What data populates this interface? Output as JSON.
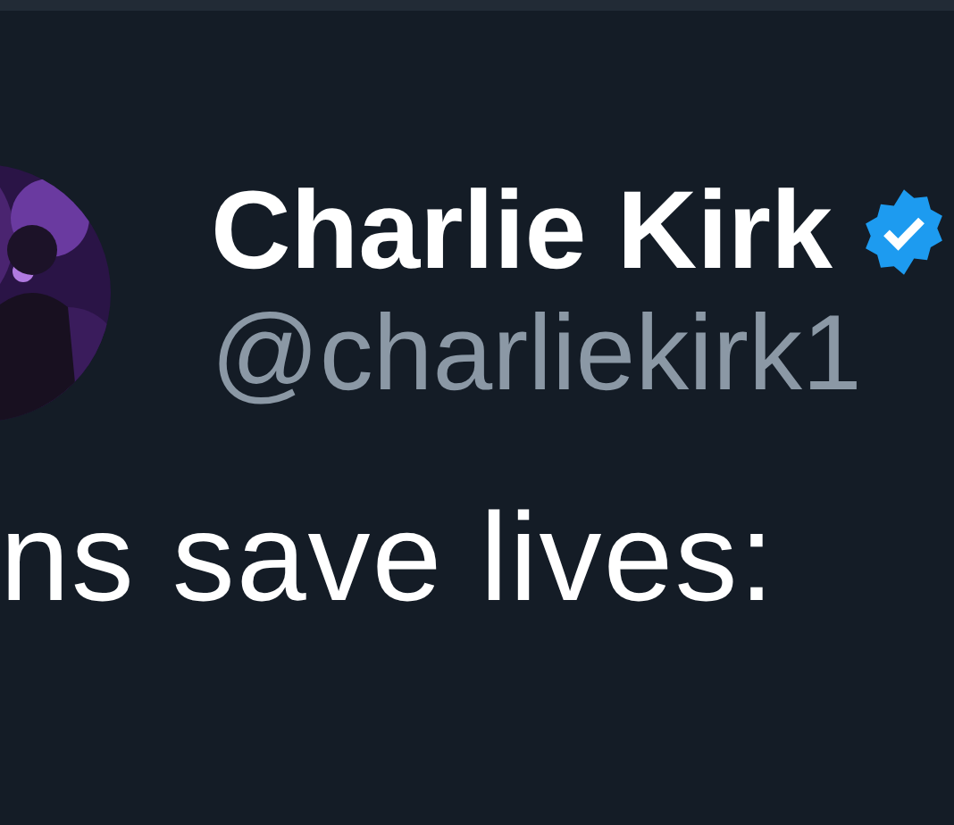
{
  "author": {
    "name": "Charlie Kirk",
    "verified": true,
    "handle": "@charliekirk1"
  },
  "tweet": {
    "text": "ns save lives:"
  }
}
